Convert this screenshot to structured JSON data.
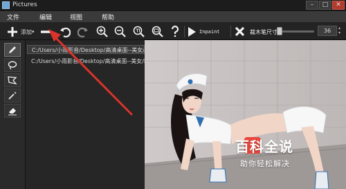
{
  "window": {
    "title": "Pictures",
    "controls": {
      "minimize": "–",
      "maximize": "□",
      "close": "✕"
    }
  },
  "menu": [
    "文件",
    "编辑",
    "视图",
    "帮助"
  ],
  "toolbar": {
    "add_label": "添加",
    "add_caret": "▾",
    "inpaint_label": "Inpaint",
    "brush_size_label": "裁木笔尺寸",
    "brush_size_value": "36",
    "spin_up": "▴",
    "spin_down": "▾",
    "brush_slider_level": 0.0,
    "icons": [
      "plus-icon",
      "minus-icon",
      "undo-icon",
      "redo-icon",
      "zoom-in-icon",
      "zoom-out-icon",
      "zoom-fit-icon",
      "zoom-actual-icon",
      "help-icon",
      "play-icon",
      "cancel-icon"
    ]
  },
  "tools": [
    "pencil-icon",
    "lasso-icon",
    "polygon-lasso-icon",
    "magic-wand-icon",
    "eraser-icon"
  ],
  "files": [
    {
      "path": "C:/Users/小雨影音/Desktop/高清桌面--美女/制服诱惑",
      "selected": true
    },
    {
      "path": "C:/Users/小雨影音/Desktop/高清桌面--美女/制服诱惑",
      "selected": false
    }
  ],
  "watermark": {
    "title": "百科全说",
    "subtitle": "助你轻松解决"
  },
  "colors": {
    "accent_red": "#d9342b",
    "watermark_red": "#e7473c",
    "panel_dark": "#232323"
  }
}
